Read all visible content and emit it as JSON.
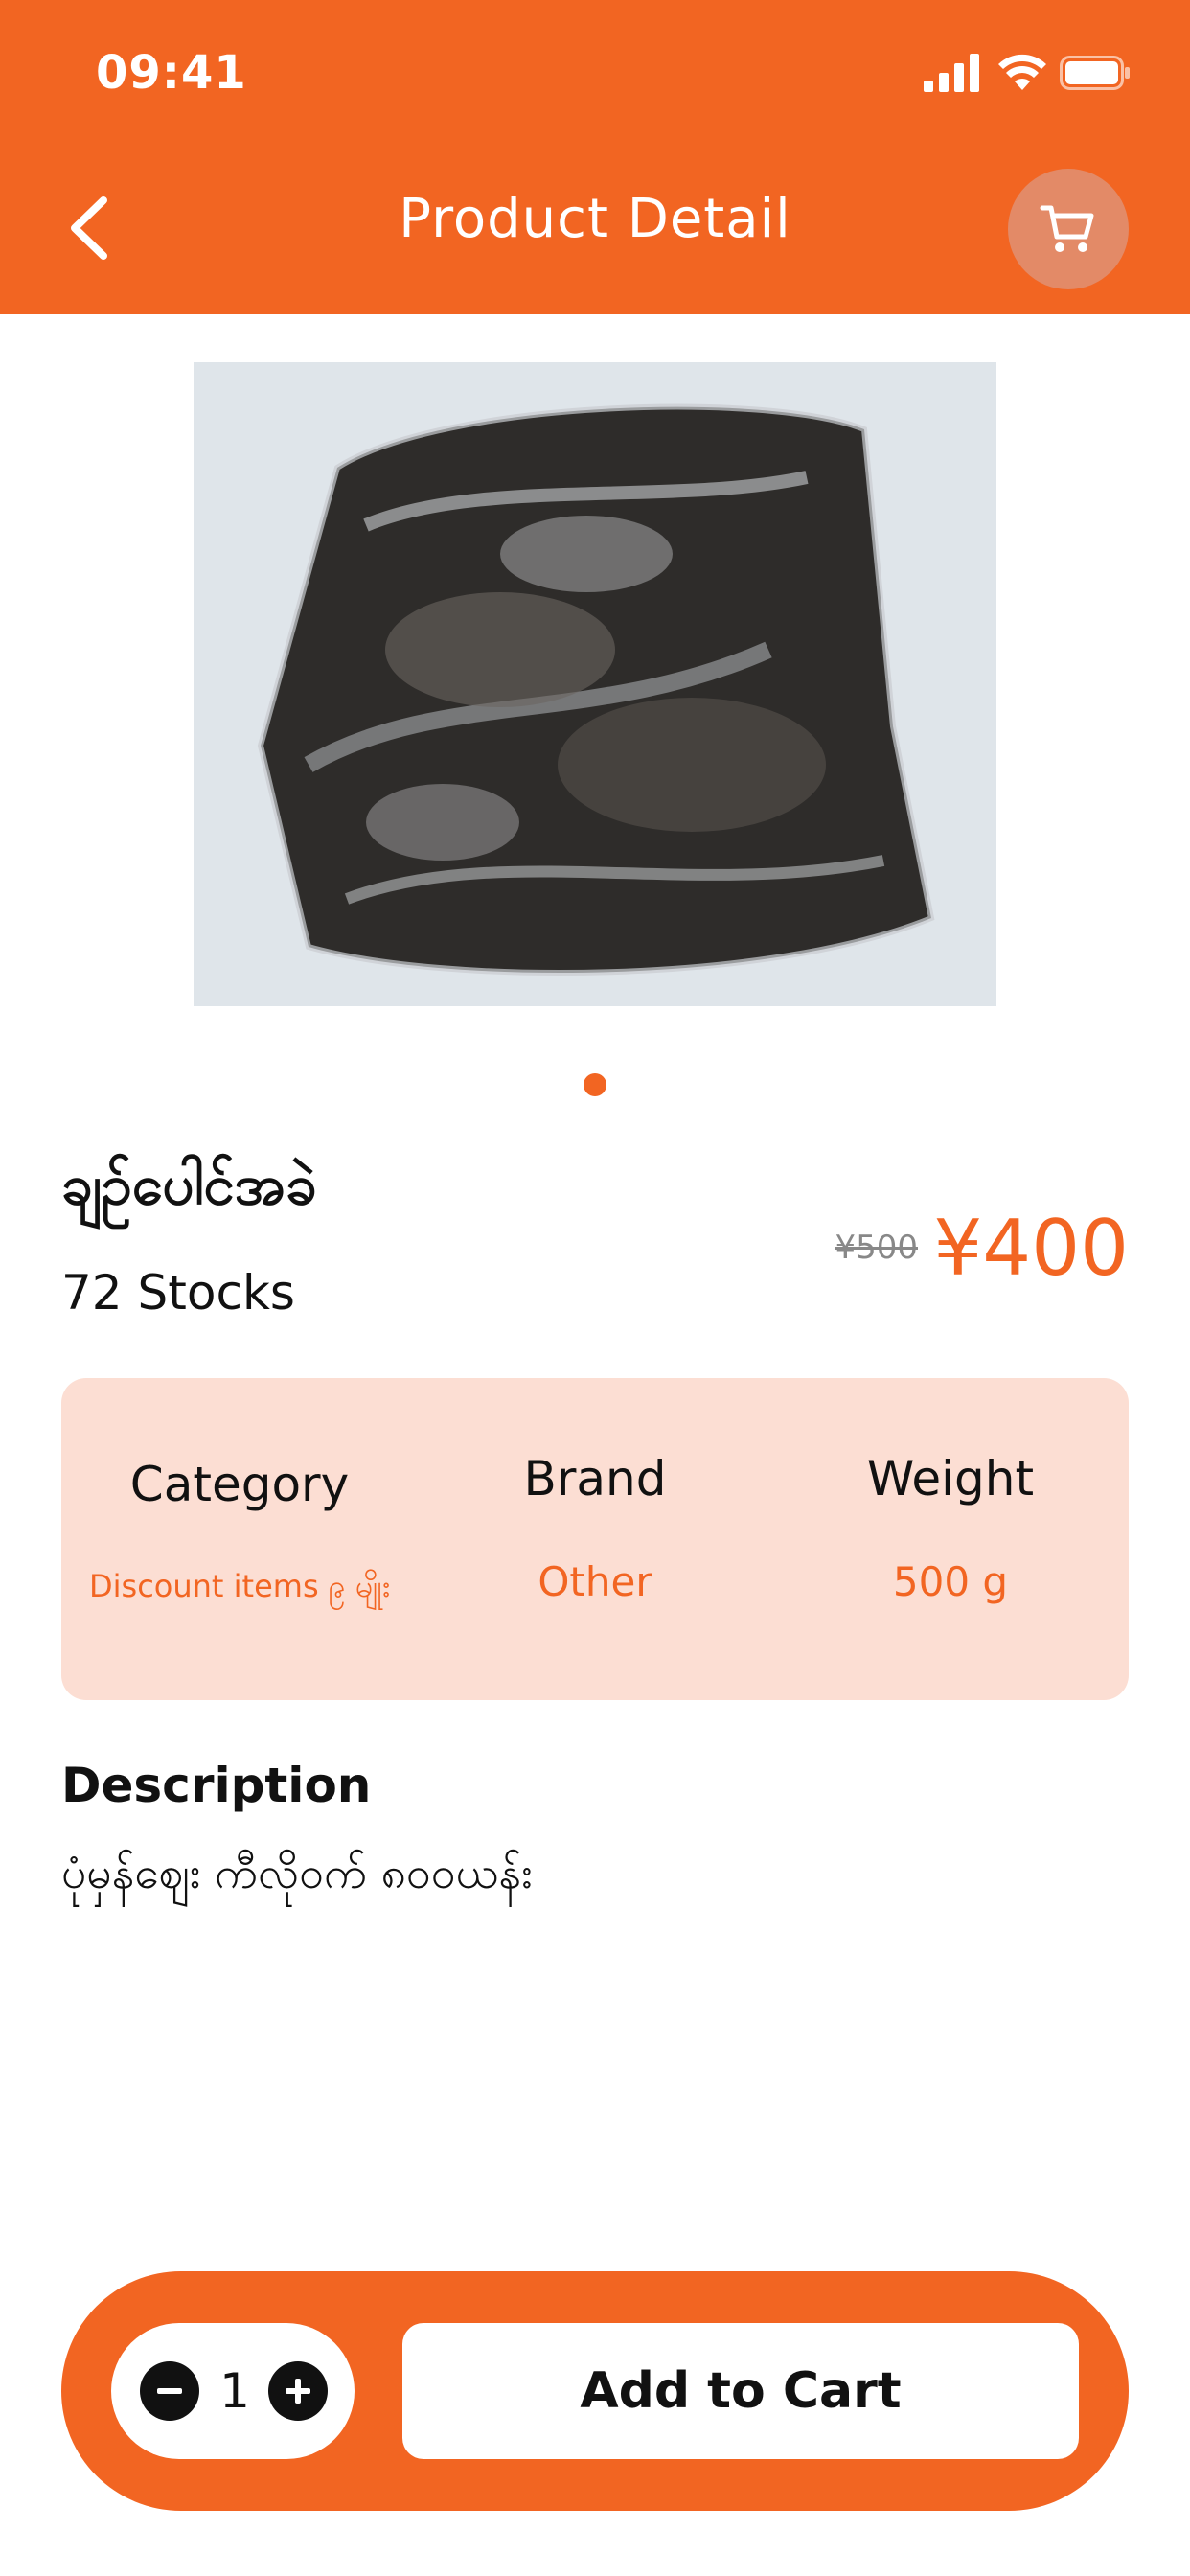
{
  "status_bar": {
    "time": "09:41"
  },
  "header": {
    "title": "Product Detail"
  },
  "icons": {
    "back": "chevron-left-icon",
    "cart": "cart-icon",
    "minus": "minus-circle-icon",
    "plus": "plus-circle-icon"
  },
  "colors": {
    "brand": "#F26522",
    "card_bg": "#FCDED3",
    "cart_btn_bg": "#E38A67"
  },
  "product": {
    "name": "ချဉ်ပေါင်အခဲ",
    "stock": "72 Stocks",
    "old_price": "¥500",
    "price": "¥400",
    "image_indicator": {
      "count": 1,
      "active_index": 0
    }
  },
  "info": [
    {
      "label": "Category",
      "value": "Discount items ၉ မျိုး"
    },
    {
      "label": "Brand",
      "value": "Other"
    },
    {
      "label": "Weight",
      "value": "500 g"
    }
  ],
  "description": {
    "title": "Description",
    "text": "ပုံမှန်ဈေး ကီလိုဝက် ၈၀၀ယန်း"
  },
  "cart_bar": {
    "quantity": "1",
    "add_label": "Add to Cart"
  }
}
